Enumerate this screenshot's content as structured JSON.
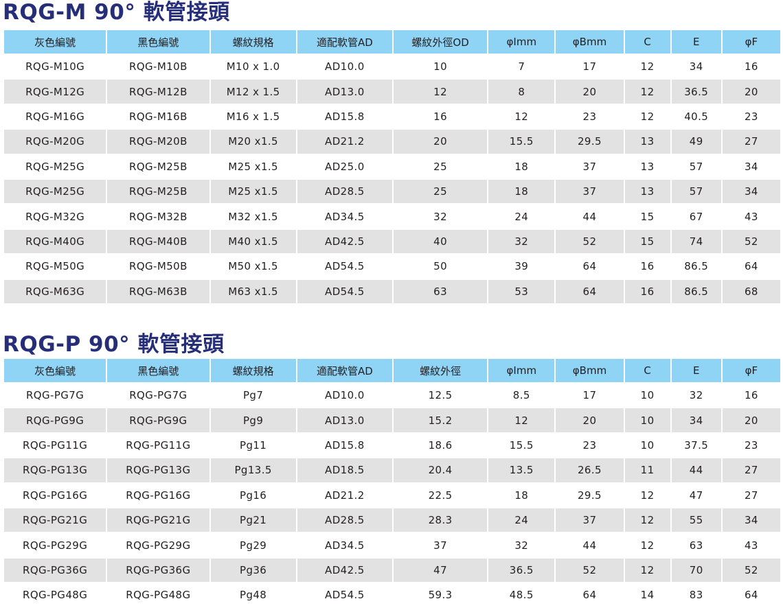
{
  "sections": [
    {
      "title": "RQG-M 90° 軟管接頭",
      "headers": [
        "灰色編號",
        "黑色編號",
        "螺紋規格",
        "適配軟管AD",
        "螺紋外徑OD",
        "φImm",
        "φBmm",
        "C",
        "E",
        "φF"
      ],
      "rows": [
        [
          "RQG-M10G",
          "RQG-M10B",
          "M10 x 1.0",
          "AD10.0",
          "10",
          "7",
          "17",
          "12",
          "34",
          "16"
        ],
        [
          "RQG-M12G",
          "RQG-M12B",
          "M12 x 1.5",
          "AD13.0",
          "12",
          "8",
          "20",
          "12",
          "36.5",
          "20"
        ],
        [
          "RQG-M16G",
          "RQG-M16B",
          "M16 x 1.5",
          "AD15.8",
          "16",
          "12",
          "23",
          "12",
          "40.5",
          "23"
        ],
        [
          "RQG-M20G",
          "RQG-M20B",
          "M20 x1.5",
          "AD21.2",
          "20",
          "15.5",
          "29.5",
          "13",
          "49",
          "27"
        ],
        [
          "RQG-M25G",
          "RQG-M25B",
          "M25 x1.5",
          "AD25.0",
          "25",
          "18",
          "37",
          "13",
          "57",
          "34"
        ],
        [
          "RQG-M25G",
          "RQG-M25B",
          "M25 x1.5",
          "AD28.5",
          "25",
          "18",
          "37",
          "13",
          "57",
          "34"
        ],
        [
          "RQG-M32G",
          "RQG-M32B",
          "M32 x1.5",
          "AD34.5",
          "32",
          "24",
          "44",
          "15",
          "67",
          "43"
        ],
        [
          "RQG-M40G",
          "RQG-M40B",
          "M40 x1.5",
          "AD42.5",
          "40",
          "32",
          "52",
          "15",
          "74",
          "52"
        ],
        [
          "RQG-M50G",
          "RQG-M50B",
          "M50 x1.5",
          "AD54.5",
          "50",
          "39",
          "64",
          "16",
          "86.5",
          "64"
        ],
        [
          "RQG-M63G",
          "RQG-M63B",
          "M63 x1.5",
          "AD54.5",
          "63",
          "53",
          "64",
          "16",
          "86.5",
          "68"
        ]
      ]
    },
    {
      "title": "RQG-P 90° 軟管接頭",
      "headers": [
        "灰色編號",
        "黑色編號",
        "螺紋規格",
        "適配軟管AD",
        "螺紋外徑",
        "φImm",
        "φBmm",
        "C",
        "E",
        "φF"
      ],
      "rows": [
        [
          "RQG-PG7G",
          "RQG-PG7G",
          "Pg7",
          "AD10.0",
          "12.5",
          "8.5",
          "17",
          "10",
          "32",
          "16"
        ],
        [
          "RQG-PG9G",
          "RQG-PG9G",
          "Pg9",
          "AD13.0",
          "15.2",
          "12",
          "20",
          "10",
          "34",
          "20"
        ],
        [
          "RQG-PG11G",
          "RQG-PG11G",
          "Pg11",
          "AD15.8",
          "18.6",
          "15.5",
          "23",
          "10",
          "37.5",
          "23"
        ],
        [
          "RQG-PG13G",
          "RQG-PG13G",
          "Pg13.5",
          "AD18.5",
          "20.4",
          "13.5",
          "26.5",
          "11",
          "44",
          "27"
        ],
        [
          "RQG-PG16G",
          "RQG-PG16G",
          "Pg16",
          "AD21.2",
          "22.5",
          "18",
          "29.5",
          "12",
          "47",
          "27"
        ],
        [
          "RQG-PG21G",
          "RQG-PG21G",
          "Pg21",
          "AD28.5",
          "28.3",
          "24",
          "37",
          "12",
          "55",
          "34"
        ],
        [
          "RQG-PG29G",
          "RQG-PG29G",
          "Pg29",
          "AD34.5",
          "37",
          "32",
          "44",
          "12",
          "63",
          "43"
        ],
        [
          "RQG-PG36G",
          "RQG-PG36G",
          "Pg36",
          "AD42.5",
          "47",
          "36.5",
          "52",
          "12",
          "70",
          "52"
        ],
        [
          "RQG-PG48G",
          "RQG-PG48G",
          "Pg48",
          "AD54.5",
          "59.3",
          "48.5",
          "64",
          "14",
          "83",
          "64"
        ]
      ]
    }
  ],
  "colors": {
    "title": "#262e7a",
    "header_bg": "#8fd3f5",
    "row_alt_bg": "#e2e2e3",
    "text": "#231f20"
  }
}
